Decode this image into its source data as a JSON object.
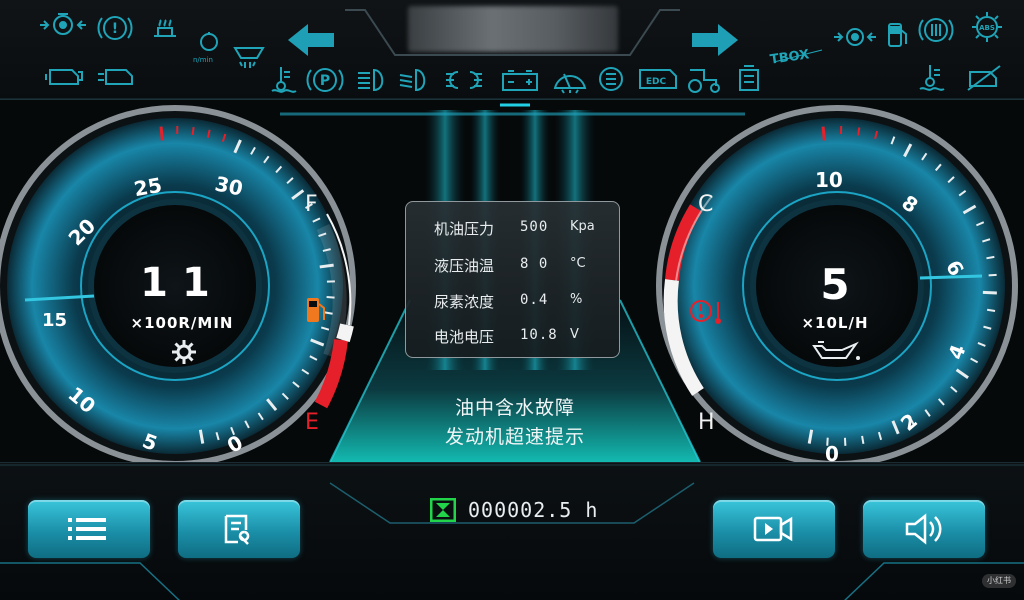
{
  "header": {
    "center_label": "",
    "tbox": "TBOX",
    "rpm_unit": "n/min",
    "edc": "EDC",
    "icons": [
      "engine-coolant-icon",
      "brake-warning-icon",
      "auxiliary-heater-icon",
      "engine-preheat-icon",
      "engine-fault-icon",
      "air-filter-icon",
      "water-temperature-icon",
      "parking-brake-icon",
      "high-beam-icon",
      "low-beam-icon",
      "position-lamp-icon",
      "battery-icon",
      "wiper-icon",
      "engine-check-icon",
      "edc-icon",
      "tractor-icon",
      "hydraulic-oil-icon",
      "tbox-icon",
      "transmission-icon",
      "fuel-icon",
      "brake-system-icon",
      "abs-icon",
      "hydraulic-temp-icon",
      "filter-icon"
    ]
  },
  "rpm_gauge": {
    "value": "11",
    "unit": "×100R/MIN",
    "ticks": [
      "0",
      "5",
      "10",
      "15",
      "20",
      "25",
      "30"
    ],
    "fuel_full_label": "F",
    "fuel_empty_label": "E",
    "fuel_level": 0.1
  },
  "fuel_gauge": {
    "value": "5",
    "unit": "×10L/H",
    "ticks": [
      "0",
      "2",
      "4",
      "6",
      "8",
      "10"
    ],
    "cold_label": "C",
    "hot_label": "H",
    "temp_level": 0.5
  },
  "params": [
    {
      "label": "机油压力",
      "value": "500",
      "unit": "Kpa"
    },
    {
      "label": "液压油温",
      "value": "8 0",
      "unit": "°C"
    },
    {
      "label": "尿素浓度",
      "value": "0.4",
      "unit": "%"
    },
    {
      "label": "电池电压",
      "value": "10.8",
      "unit": "V"
    }
  ],
  "alarms": [
    "油中含水故障",
    "发动机超速提示"
  ],
  "engine_hours": "000002.5 h",
  "buttons": [
    "menu-button",
    "diagnostics-button",
    "camera-button",
    "volume-button"
  ],
  "colors": {
    "accent": "#1fb6d0",
    "warning": "#e6202a",
    "fuel_icon": "#f0781e",
    "hours_icon": "#22d44a"
  },
  "watermark": "小红书"
}
